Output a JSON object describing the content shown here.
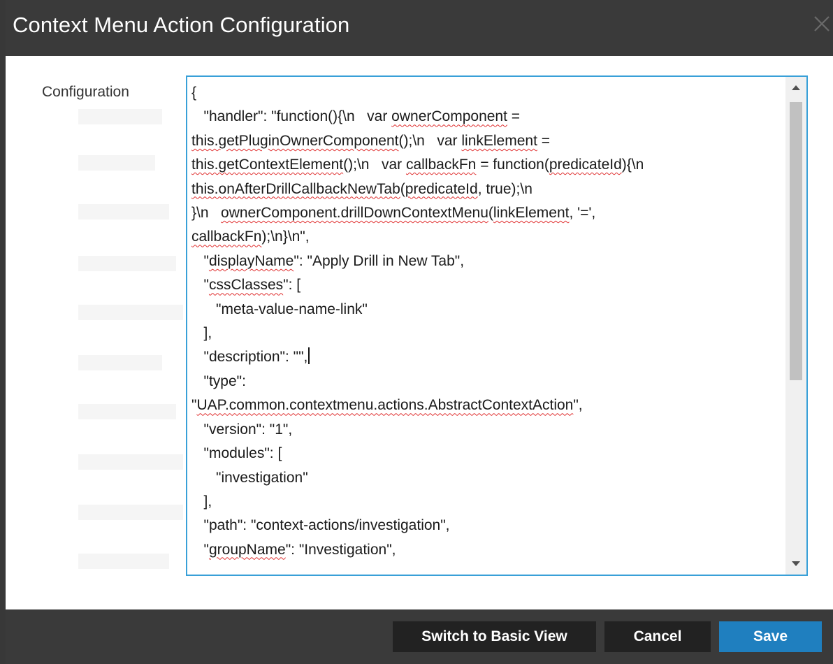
{
  "dialog": {
    "title": "Context Menu Action Configuration",
    "close_icon": "close-icon"
  },
  "form": {
    "configuration_label": "Configuration"
  },
  "editor": {
    "lines": [
      "{",
      "   \"handler\": \"function(){\\n   var ownerComponent =",
      "this.getPluginOwnerComponent();\\n   var linkElement =",
      "this.getContextElement();\\n   var callbackFn = function(predicateId){\\n",
      "this.onAfterDrillCallbackNewTab(predicateId, true);\\n",
      "}\\n   ownerComponent.drillDownContextMenu(linkElement, '=',",
      "callbackFn);\\n}\\n\",",
      "   \"displayName\": \"Apply Drill in New Tab\",",
      "   \"cssClasses\": [",
      "      \"meta-value-name-link\"",
      "   ],",
      "   \"description\": \"\",",
      "   \"type\":",
      "\"UAP.common.contextmenu.actions.AbstractContextAction\",",
      "   \"version\": \"1\",",
      "   \"modules\": [",
      "      \"investigation\"",
      "   ],",
      "   \"path\": \"context-actions/investigation\",",
      "   \"groupName\": \"Investigation\","
    ],
    "scroll_up_icon": "triangle-up-icon",
    "scroll_down_icon": "triangle-down-icon"
  },
  "footer": {
    "switch_basic_label": "Switch to Basic View",
    "cancel_label": "Cancel",
    "save_label": "Save"
  },
  "colors": {
    "titlebar": "#3a3a3a",
    "editor_border": "#39a0d8",
    "primary_button": "#1f7fbf",
    "secondary_button": "#222222",
    "spellcheck": "#e03030"
  }
}
